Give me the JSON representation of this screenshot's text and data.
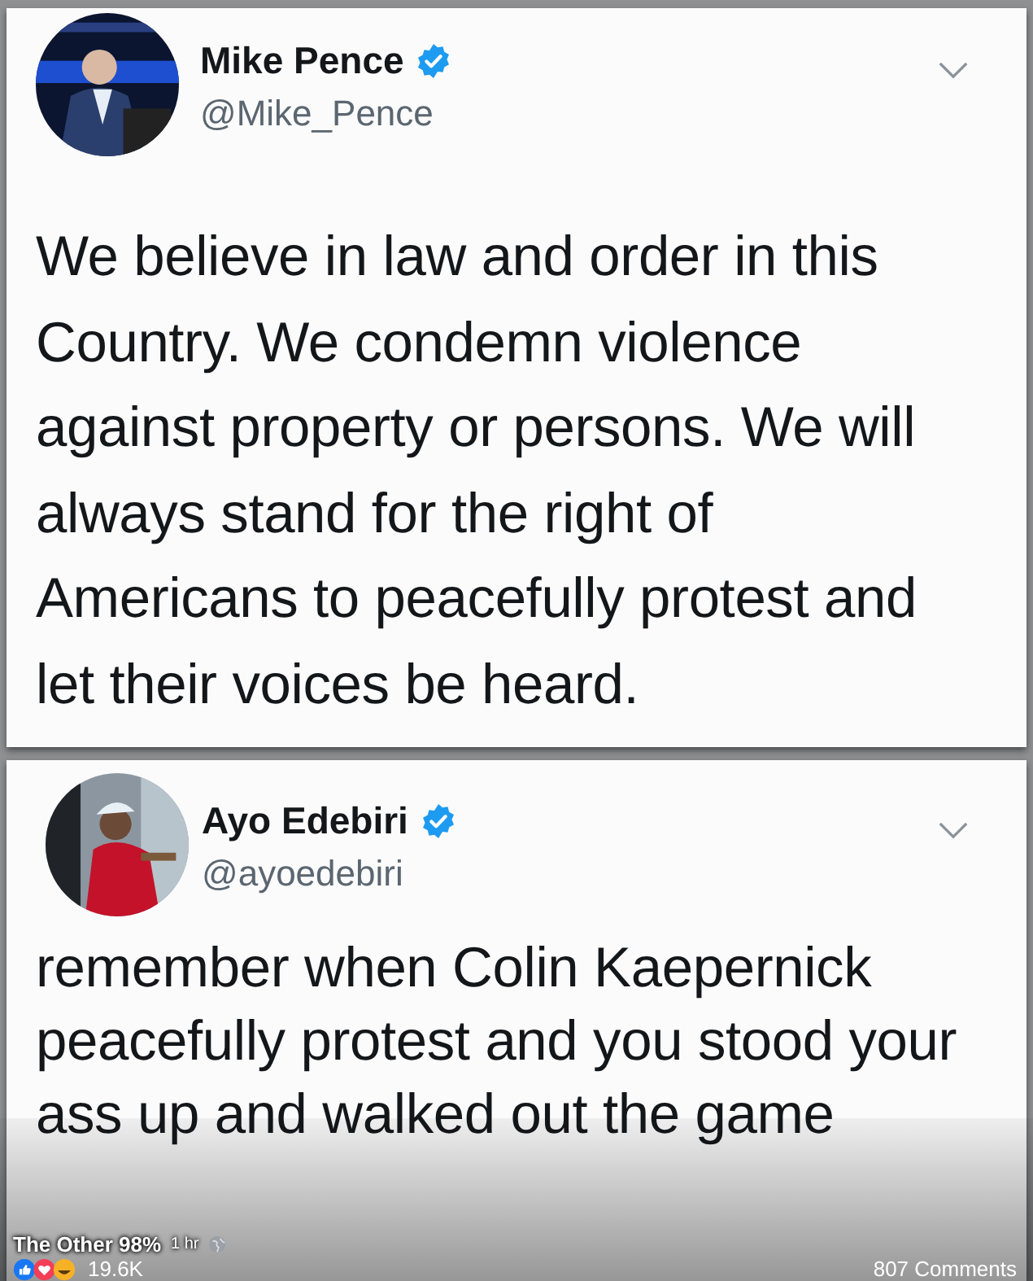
{
  "tweets": [
    {
      "name": "Mike Pence",
      "handle": "@Mike_Pence",
      "verified": true,
      "text": "We believe in law and order in this Country. We condemn violence against property or persons. We will always stand for the right of Americans to peacefully protest and let their voices be heard."
    },
    {
      "name": "Ayo Edebiri",
      "handle": "@ayoedebiri",
      "verified": true,
      "text": "remember when Colin Kaepernick peacefully protest and you stood your ass up and walked out the game"
    }
  ],
  "post_overlay": {
    "page_name": "The Other 98%",
    "time": "1 hr",
    "reaction_count": "19.6K",
    "comments": "807 Comments"
  }
}
